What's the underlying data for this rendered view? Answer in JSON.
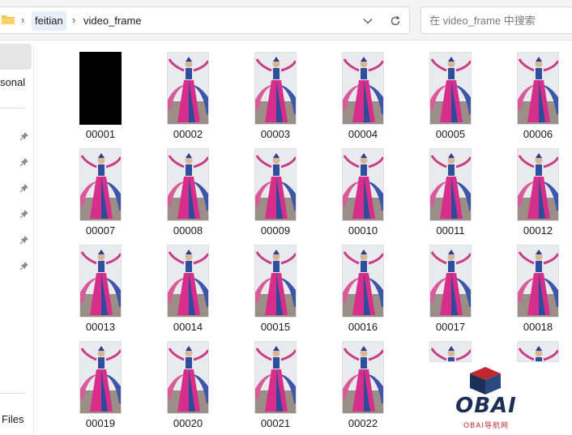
{
  "breadcrumb": {
    "items": [
      "feitian",
      "video_frame"
    ],
    "separator": "›"
  },
  "search": {
    "placeholder": "在 video_frame 中搜索"
  },
  "nav": {
    "items": [
      {
        "label": "sonal"
      },
      {
        "label": "Files"
      }
    ],
    "pinned_count": 6
  },
  "files": [
    {
      "name": "00001",
      "thumbnail": "black-frame"
    },
    {
      "name": "00002",
      "thumbnail": "dancer-frame"
    },
    {
      "name": "00003",
      "thumbnail": "dancer-frame"
    },
    {
      "name": "00004",
      "thumbnail": "dancer-frame"
    },
    {
      "name": "00005",
      "thumbnail": "dancer-frame"
    },
    {
      "name": "00006",
      "thumbnail": "dancer-frame"
    },
    {
      "name": "00007",
      "thumbnail": "dancer-frame"
    },
    {
      "name": "00008",
      "thumbnail": "dancer-frame"
    },
    {
      "name": "00009",
      "thumbnail": "dancer-frame"
    },
    {
      "name": "00010",
      "thumbnail": "dancer-frame"
    },
    {
      "name": "00011",
      "thumbnail": "dancer-frame"
    },
    {
      "name": "00012",
      "thumbnail": "dancer-frame"
    },
    {
      "name": "00013",
      "thumbnail": "dancer-frame"
    },
    {
      "name": "00014",
      "thumbnail": "dancer-frame"
    },
    {
      "name": "00015",
      "thumbnail": "dancer-frame"
    },
    {
      "name": "00016",
      "thumbnail": "dancer-frame"
    },
    {
      "name": "00017",
      "thumbnail": "dancer-frame"
    },
    {
      "name": "00018",
      "thumbnail": "dancer-frame"
    },
    {
      "name": "00019",
      "thumbnail": "dancer-frame"
    },
    {
      "name": "00020",
      "thumbnail": "dancer-frame"
    },
    {
      "name": "00021",
      "thumbnail": "dancer-frame"
    },
    {
      "name": "00022",
      "thumbnail": "dancer-frame"
    }
  ],
  "watermark": {
    "title": "OBAI",
    "subtitle": "OBAI导航网"
  },
  "icons": [
    "folder-icon",
    "chevron-right-icon",
    "chevron-down-icon",
    "refresh-icon",
    "pin-icon"
  ],
  "colors": {
    "breadcrumb_highlight": "#e6eef7",
    "folder": "#f2c14e",
    "watermark_navy": "#1c3057",
    "watermark_red": "#c2272d"
  }
}
